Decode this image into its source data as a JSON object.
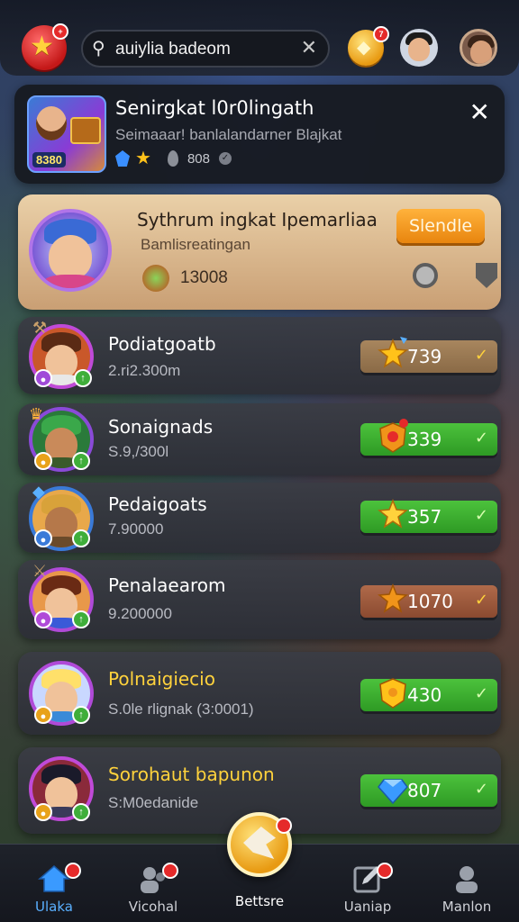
{
  "header": {
    "search_value": "auiylia badeom",
    "coin_badge": "7",
    "logo_badge": "+"
  },
  "featured": {
    "title": "Senirgkat l0r0lingath",
    "subtitle": "Seimaaar! banlalandarner Blajkat",
    "thumb_tag": "8380",
    "count": "808",
    "close": "✕"
  },
  "highlight": {
    "title": "Sythrum ingkat Ipemarliaa",
    "subtitle": "Bamlisreatingan",
    "score": "13008",
    "button": "Slendle"
  },
  "players": [
    {
      "name": "Podiatgoatb",
      "meta": "2.ri2.300m",
      "value": "739",
      "pill": "tan",
      "icon": "star-burst",
      "name_color": "#ffffff"
    },
    {
      "name": "Sonaignads",
      "meta": "S.9,/300l",
      "value": "339",
      "pill": "green",
      "icon": "shield-heart",
      "name_color": "#ffffff"
    },
    {
      "name": "Pedaigoats",
      "meta": "7.90000",
      "value": "357",
      "pill": "green",
      "icon": "star",
      "name_color": "#ffffff"
    },
    {
      "name": "Penalaearom",
      "meta": "9.200000",
      "value": "1070",
      "pill": "red",
      "icon": "star-orange",
      "name_color": "#ffffff"
    },
    {
      "name": "Polnaigiecio",
      "meta": "S.0le rlignak (3:0001)",
      "value": "430",
      "pill": "green",
      "icon": "shield-gold",
      "name_color": "#ffd23c"
    },
    {
      "name": "Sorohaut bapunon",
      "meta": "S:M0edanide",
      "value": "807",
      "pill": "green",
      "icon": "gem",
      "name_color": "#ffd23c"
    }
  ],
  "nav": {
    "items": [
      {
        "label": "Ulaka",
        "icon": "home-icon"
      },
      {
        "label": "Vicohal",
        "icon": "people-icon"
      },
      {
        "label": "Bettsre",
        "icon": "battle-icon"
      },
      {
        "label": "Uaniap",
        "icon": "edit-icon"
      },
      {
        "label": "Manlon",
        "icon": "profile-icon"
      }
    ]
  },
  "colors": {
    "accent_orange": "#f0941a",
    "accent_green": "#3fae3a",
    "highlight_bg": "#e6c59c"
  }
}
